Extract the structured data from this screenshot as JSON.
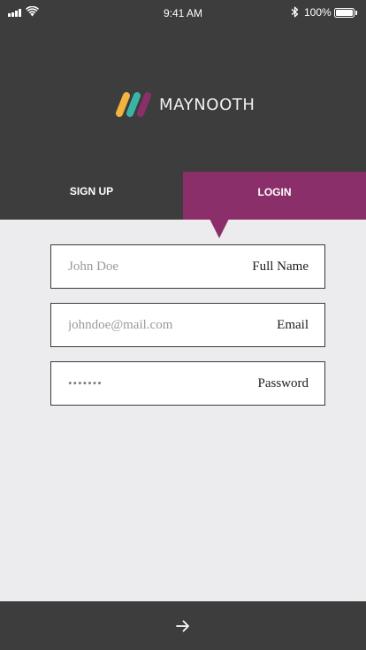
{
  "status_bar": {
    "time": "9:41 AM",
    "battery_percent": "100%",
    "battery_level": 1.0,
    "icons": [
      "signal-icon",
      "wifi-icon",
      "bluetooth-icon",
      "battery-icon"
    ]
  },
  "brand": {
    "name": "MAYNOOTH",
    "logo_colors": [
      "#f3b33d",
      "#3bb3a5",
      "#8b2f6b"
    ]
  },
  "tabs": [
    {
      "label": "SIGN UP",
      "active": false
    },
    {
      "label": "LOGIN",
      "active": true
    }
  ],
  "form": {
    "full_name": {
      "label": "Full Name",
      "placeholder": "John Doe"
    },
    "email": {
      "label": "Email",
      "placeholder": "johndoe@mail.com"
    },
    "password": {
      "label": "Password",
      "value": "•••••••"
    }
  },
  "footer": {
    "submit_icon": "arrow-right-icon"
  },
  "colors": {
    "header_bg": "#3d3d3d",
    "accent": "#8b2f6b",
    "body_bg": "#ececee"
  }
}
